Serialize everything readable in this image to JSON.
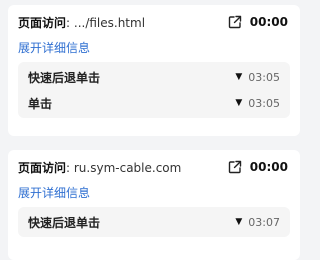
{
  "cards": [
    {
      "title_label": "页面访问",
      "title_value": ": .../files.html",
      "duration": "00:00",
      "expand_label": "展开详细信息",
      "events": [
        {
          "label": "快速后退单击",
          "time": "03:05"
        },
        {
          "label": "单击",
          "time": "03:05"
        }
      ]
    },
    {
      "title_label": "页面访问",
      "title_value": ": ru.sym-cable.com",
      "duration": "00:00",
      "expand_label": "展开详细信息",
      "events": [
        {
          "label": "快速后退单击",
          "time": "03:07"
        }
      ]
    }
  ],
  "icons": {
    "open": "external-link-icon",
    "marker": "triangle-down-icon"
  }
}
